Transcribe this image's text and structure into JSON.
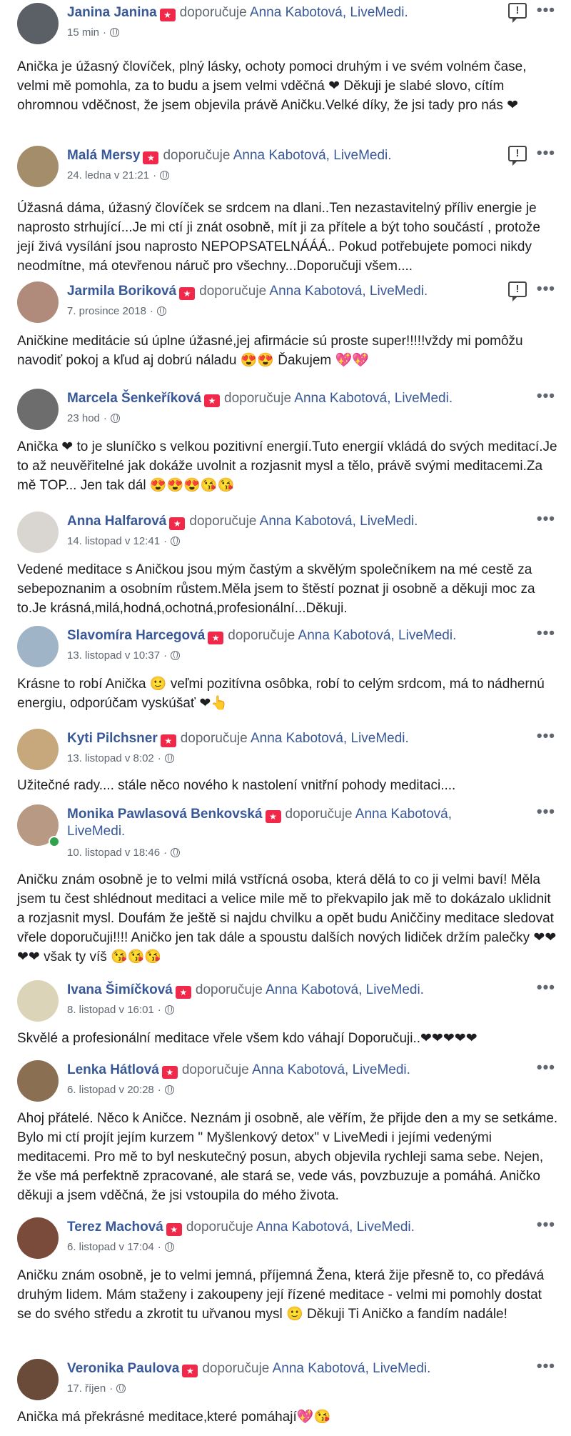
{
  "common": {
    "verb": "doporučuje",
    "page_name": "Anna Kabotová, LiveMedi.",
    "report_icon": "!",
    "menu_icon": "•••"
  },
  "reviews": [
    {
      "name": "Janina Janina",
      "time": "15 min",
      "text": "Anička je úžasný človíček, plný lásky, ochoty pomoci druhým i ve svém volném čase, velmi mě pomohla, za to budu a jsem velmi vděčná ❤ Děkuji je slabé slovo, cítím ohromnou vděčnost, že jsem objevila právě Aničku.Velké díky, že jsi tady pro nás ❤"
    },
    {
      "name": "Malá Mersy",
      "time": "24. ledna v 21:21",
      "text": "Úžasná dáma, úžasný človíček se srdcem na dlani..Ten nezastavitelný příliv energie je naprosto strhující...Je mi ctí ji znát osobně, mít ji za přítele a být toho součástí , protože její živá vysílání jsou naprosto NEPOPSATELNÁÁÁ.. Pokud potřebujete pomoci nikdy neodmítne, má otevřenou náruč pro všechny...Doporučuji všem...."
    },
    {
      "name": "Jarmila Boriková",
      "time": "7. prosince 2018",
      "text": "Aničkine meditácie sú úplne úžasné,jej afirmácie sú proste super!!!!!vždy mi pomôžu navodiť pokoj a kľud aj dobrú náladu 😍😍 Ďakujem 💖💖"
    },
    {
      "name": "Marcela Šenkeříková",
      "time": "23 hod",
      "text": "Anička ❤ to je sluníčko s velkou pozitivní energií.Tuto energií vkládá do svých meditací.Je to až neuvěřitelné jak dokáže uvolnit a rozjasnit mysl a tělo, právě svými meditacemi.Za mě TOP... Jen tak dál 😍😍😍😘😘"
    },
    {
      "name": "Anna Halfarová",
      "time": "14. listopad v 12:41",
      "text": "Vedené meditace s Aničkou jsou mým častým a skvělým společníkem na mé cestě za sebepoznanim a osobním růstem.Měla jsem to štěstí poznat ji osobně a děkuji moc za to.Je krásná,milá,hodná,ochotná,profesionální...Děkuji."
    },
    {
      "name": "Slavomíra Harcegová",
      "time": "13. listopad v 10:37",
      "text": "Krásne to robí Anička 🙂 veľmi pozitívna osôbka, robí to celým srdcom, má to nádhernú energiu, odporúčam vyskúšať ❤👆"
    },
    {
      "name": "Kyti Pilchsner",
      "time": "13. listopad v 8:02",
      "text": "Užitečné rady.... stále něco nového k nastolení vnitřní pohody meditaci...."
    },
    {
      "name": "Monika Pawlasová Benkovská",
      "time": "10. listopad v 18:46",
      "text": "Aničku znám osobně je to velmi milá vstřícná osoba, která dělá to co ji velmi baví! Měla jsem tu čest shlédnout meditaci a velice mile mě to překvapilo jak mě to dokázalo uklidnit a rozjasnit mysl. Doufám že ještě si najdu chvilku a opět budu Aniččiny meditace sledovat vřele doporučuji!!!! Aničko jen tak dále a spoustu dalších nových lidiček držím palečky ❤❤❤❤ však ty víš 😘😘😘"
    },
    {
      "name": "Ivana Šimíčková",
      "time": "8. listopad v 16:01",
      "text": "Skvělé a profesionální meditace vřele všem kdo váhají Doporučuji..❤❤❤❤❤"
    },
    {
      "name": "Lenka Hátlová",
      "time": "6. listopad v 20:28",
      "text": "Ahoj přátelé. Něco k Aničce. Neznám ji osobně, ale věřím, že přijde den a my se setkáme. Bylo mi ctí projít jejím kurzem \" Myšlenkový detox\" v LiveMedi i jejími vedenými meditacemi. Pro mě to byl neskutečný posun, abych objevila rychleji sama sebe. Nejen, že vše má perfektně zpracované, ale stará se, vede vás, povzbuzuje a pomáhá. Aničko děkuji a jsem vděčná, že jsi vstoupila do mého života."
    },
    {
      "name": "Terez Machová",
      "time": "6. listopad v 17:04",
      "text": "Aničku znám osobně, je to velmi jemná, příjemná Žena, která žije přesně to, co předává druhým lidem. Mám staženy i zakoupeny její řízené meditace - velmi mi pomohly dostat se do svého středu a zkrotit tu uřvanou mysl 🙂 Děkuji Ti Aničko a fandím nadále!"
    },
    {
      "name": "Veronika Paulova",
      "time": "17. říjen",
      "text": "Anička má překrásné meditace,které pomáhají💖😘"
    }
  ]
}
